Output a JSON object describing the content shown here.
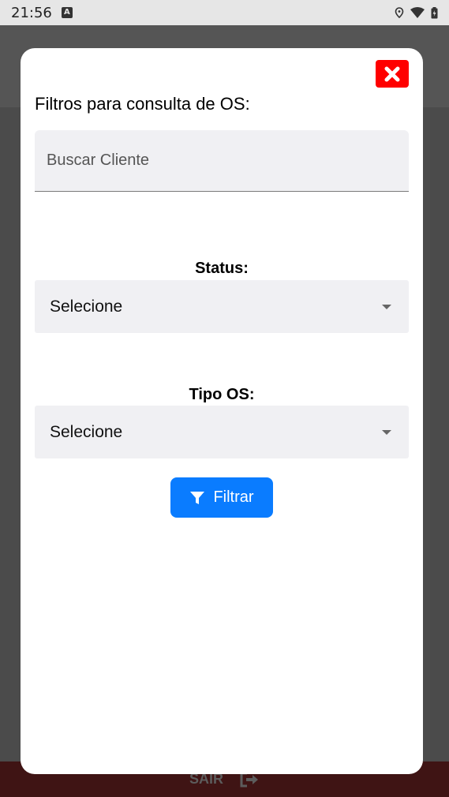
{
  "status_bar": {
    "time": "21:56",
    "notification_icon": "a-notification-icon",
    "icons": [
      "location-icon",
      "wifi-icon",
      "battery-icon"
    ]
  },
  "modal": {
    "title": "Filtros para consulta de OS:",
    "close_icon": "close-icon",
    "search": {
      "placeholder": "Buscar Cliente",
      "value": ""
    },
    "status": {
      "label": "Status:",
      "selected": "Selecione"
    },
    "tipo_os": {
      "label": "Tipo OS:",
      "selected": "Selecione"
    },
    "filter_button": {
      "label": "Filtrar",
      "icon": "filter-icon"
    }
  },
  "bottom_bar": {
    "logout_label": "SAIR",
    "logout_icon": "logout-icon"
  },
  "colors": {
    "close_button": "#ff0000",
    "primary_button": "#0a7cff",
    "field_background": "#f0f0f3",
    "bottom_bar": "#3f1414"
  }
}
